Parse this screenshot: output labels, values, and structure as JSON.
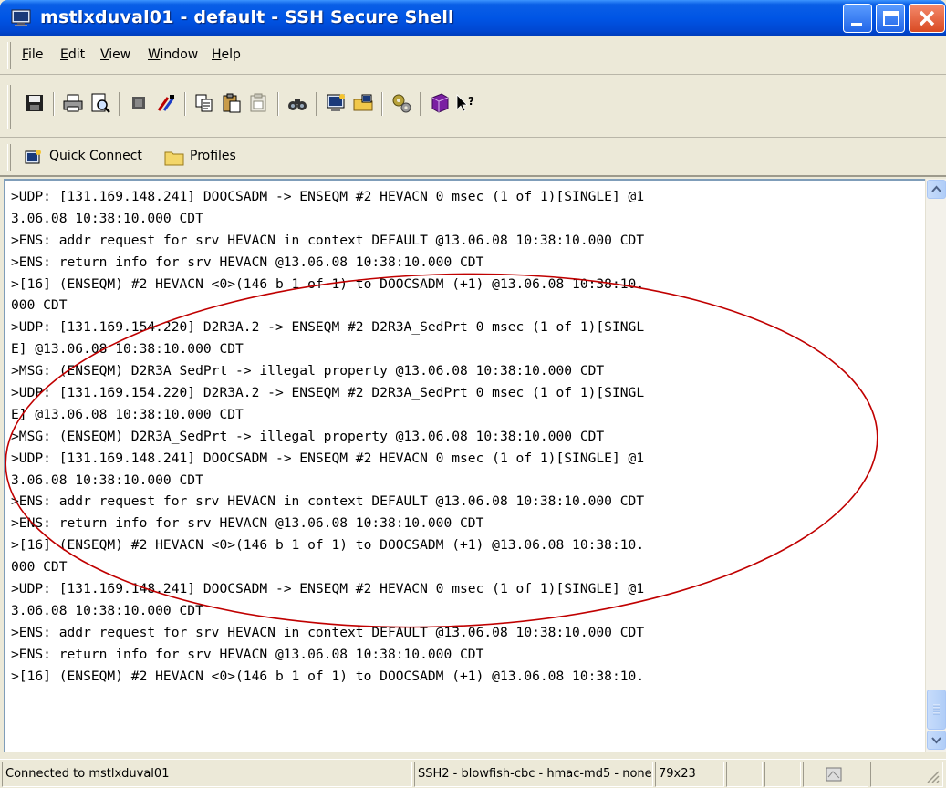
{
  "window": {
    "title": "mstlxduval01 - default - SSH Secure Shell"
  },
  "menu": {
    "items": [
      "File",
      "Edit",
      "View",
      "Window",
      "Help"
    ]
  },
  "toolbar": {
    "icons": [
      "save-icon",
      "print-icon",
      "print-preview-icon",
      "disconnect-icon",
      "reconnect-icon",
      "copy-icon",
      "paste-icon",
      "paste-disabled-icon",
      "find-icon",
      "new-terminal-icon",
      "new-file-transfer-icon",
      "settings-icon",
      "help-topics-icon",
      "context-help-icon"
    ]
  },
  "quickbar": {
    "quick_connect": "Quick Connect",
    "profiles": "Profiles"
  },
  "terminal": {
    "lines": [
      ">UDP: [131.169.148.241] DOOCSADM -> ENSEQM #2 HEVACN 0 msec (1 of 1)[SINGLE] @1",
      "3.06.08 10:38:10.000 CDT",
      ">ENS: addr request for srv HEVACN in context DEFAULT @13.06.08 10:38:10.000 CDT",
      ">ENS: return info for srv HEVACN @13.06.08 10:38:10.000 CDT",
      ">[16] (ENSEQM) #2 HEVACN <0>(146 b 1 of 1) to DOOCSADM (+1) @13.06.08 10:38:10.",
      "000 CDT",
      ">UDP: [131.169.154.220] D2R3A.2 -> ENSEQM #2 D2R3A_SedPrt 0 msec (1 of 1)[SINGL",
      "E] @13.06.08 10:38:10.000 CDT",
      ">MSG: (ENSEQM) D2R3A_SedPrt -> illegal property @13.06.08 10:38:10.000 CDT",
      ">UDP: [131.169.154.220] D2R3A.2 -> ENSEQM #2 D2R3A_SedPrt 0 msec (1 of 1)[SINGL",
      "E] @13.06.08 10:38:10.000 CDT",
      ">MSG: (ENSEQM) D2R3A_SedPrt -> illegal property @13.06.08 10:38:10.000 CDT",
      ">UDP: [131.169.148.241] DOOCSADM -> ENSEQM #2 HEVACN 0 msec (1 of 1)[SINGLE] @1",
      "3.06.08 10:38:10.000 CDT",
      ">ENS: addr request for srv HEVACN in context DEFAULT @13.06.08 10:38:10.000 CDT",
      ">ENS: return info for srv HEVACN @13.06.08 10:38:10.000 CDT",
      ">[16] (ENSEQM) #2 HEVACN <0>(146 b 1 of 1) to DOOCSADM (+1) @13.06.08 10:38:10.",
      "000 CDT",
      ">UDP: [131.169.148.241] DOOCSADM -> ENSEQM #2 HEVACN 0 msec (1 of 1)[SINGLE] @1",
      "3.06.08 10:38:10.000 CDT",
      ">ENS: addr request for srv HEVACN in context DEFAULT @13.06.08 10:38:10.000 CDT",
      ">ENS: return info for srv HEVACN @13.06.08 10:38:10.000 CDT",
      ">[16] (ENSEQM) #2 HEVACN <0>(146 b 1 of 1) to DOOCSADM (+1) @13.06.08 10:38:10."
    ],
    "annotation_color": "#c00000"
  },
  "statusbar": {
    "connection": "Connected to mstlxduval01",
    "cipher": "SSH2 - blowfish-cbc - hmac-md5 - none",
    "size": "79x23"
  },
  "colors": {
    "titlebar": "#0055e5",
    "chrome": "#ece9d8"
  }
}
